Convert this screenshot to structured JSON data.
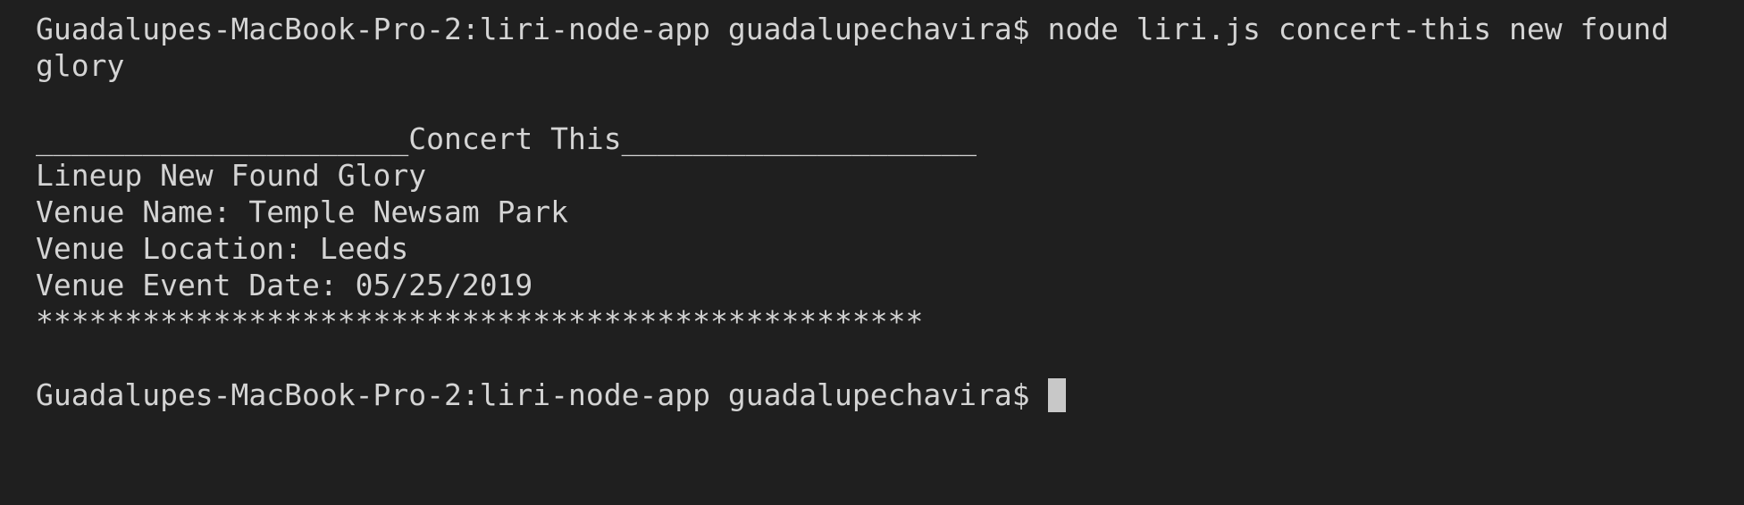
{
  "terminal": {
    "command_line_1": "Guadalupes-MacBook-Pro-2:liri-node-app guadalupechavira$ node liri.js concert-this new found",
    "command_line_2": "glory",
    "section_header": "_____________________Concert This____________________",
    "lineup": "Lineup New Found Glory",
    "venue_name": "Venue Name: Temple Newsam Park",
    "venue_location": "Venue Location: Leeds",
    "event_date": "Venue Event Date: 05/25/2019",
    "separator": "**************************************************",
    "prompt": "Guadalupes-MacBook-Pro-2:liri-node-app guadalupechavira$"
  },
  "colors": {
    "background": "#1f1f1f",
    "text": "#d4d4d4",
    "cursor": "#c8c8c8"
  }
}
